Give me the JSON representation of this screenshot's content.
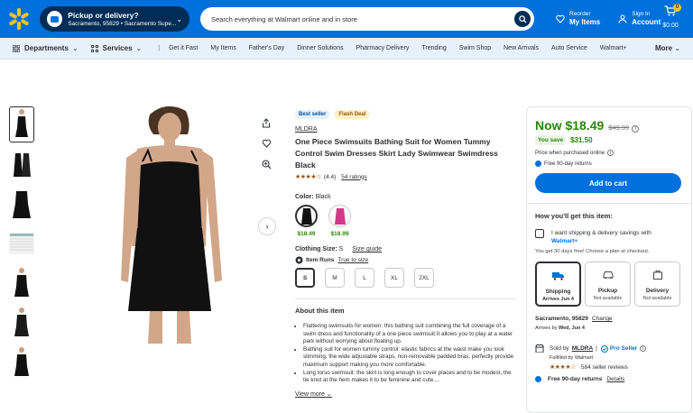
{
  "header": {
    "pickup_title": "Pickup or delivery?",
    "pickup_sub": "Sacramento, 95829 • Sacramento Supe...",
    "search_placeholder": "Search everything at Walmart online and in store",
    "reorder_small": "Reorder",
    "reorder_big": "My Items",
    "signin_small": "Sign In",
    "signin_big": "Account",
    "cart_count": "0",
    "cart_total": "$0.00"
  },
  "nav": {
    "departments": "Departments",
    "services": "Services",
    "links": [
      "Get it Fast",
      "My Items",
      "Father's Day",
      "Dinner Solutions",
      "Pharmacy Delivery",
      "Trending",
      "Swim Shop",
      "New Arrivals",
      "Auto Service",
      "Walmart+"
    ],
    "more": "More"
  },
  "product": {
    "tag_best": "Best seller",
    "tag_flash": "Flash Deal",
    "brand": "MLDRA",
    "title": "One Piece Swimsuits Bathing Suit for Women Tummy Control Swim Dresses Skirt Lady Swimwear Swimdress Black",
    "stars": "★★★★☆",
    "rating_value": "(4.4)",
    "rating_count": "54 ratings",
    "color_label": "Color:",
    "color_value": "Black",
    "swatch_prices": [
      "$18.49",
      "$18.99"
    ],
    "size_label": "Clothing Size:",
    "size_value": "S",
    "size_guide": "Size guide",
    "item_runs": "Item Runs",
    "true_to_size": "True to size",
    "sizes": [
      "S",
      "M",
      "L",
      "XL",
      "2XL"
    ],
    "about_title": "About this item",
    "about_items": [
      "Flattering swimsuits for women: this bathing suit combining the full coverage of a swim dress and functionality of a one piece swimsuit.It allows you to play at a water park without worrying about floating up.",
      "Bathing suit for women tummy control: elastic fabrics at the waist make you look slimming, the wide adjustable straps, non-removable padded bras, perfectly provide maximum support making you more comfortable.",
      "Long torso swimsuit: the skirt is long enough to cover places and to be modest, the tie knot at the hem makes it to be feminine and cute...."
    ],
    "view_more": "View more"
  },
  "buybox": {
    "now_price": "Now $18.49",
    "was_price": "$49.99",
    "info": "i",
    "you_save_label": "You save",
    "you_save_amount": "$31.50",
    "price_when_purchased": "Price when purchased online",
    "free_returns": "Free 90-day returns",
    "add_to_cart": "Add to cart",
    "how_get": "How you'll get this item:",
    "ship_opt_text": "I want shipping & delivery savings with",
    "walmart_plus": "Walmart+",
    "trial": "You get 30 days free! Choose a plan at checkout.",
    "fulfillment": [
      {
        "name": "Shipping",
        "status": "Arrives Jun 4"
      },
      {
        "name": "Pickup",
        "status": "Not available"
      },
      {
        "name": "Delivery",
        "status": "Not available"
      }
    ],
    "location": "Sacramento, 95829",
    "change": "Change",
    "arrives_prefix": "Arrives by",
    "arrives_date": "Wed, Jun 4",
    "sold_by": "Sold by",
    "seller_name": "MLDRA",
    "pro_seller": "Pro Seller",
    "fulfilled_by": "Fulfilled by Walmart",
    "seller_stars": "★★★★☆",
    "seller_reviews": "584 seller reviews",
    "returns": "Free 90-day returns",
    "details": "Details"
  },
  "colors": {
    "walmart_blue": "#0071dc",
    "walmart_yellow": "#ffc220",
    "dark_navy": "#002d58",
    "price_green": "#2a8703"
  }
}
